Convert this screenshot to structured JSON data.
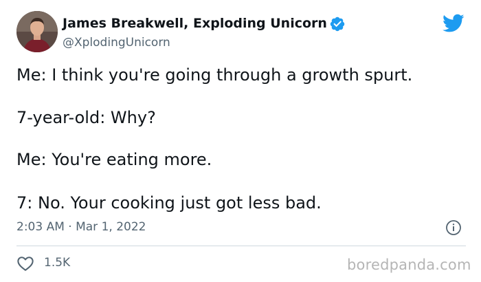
{
  "tweet": {
    "author": {
      "display_name": "James Breakwell, Exploding Unicorn",
      "handle": "@XplodingUnicorn",
      "verified": true
    },
    "lines": [
      "Me: I think you're going through a growth spurt.",
      "7-year-old: Why?",
      "Me: You're eating more.",
      "7: No. Your cooking just got less bad."
    ],
    "timestamp": "2:03 AM · Mar 1, 2022",
    "likes": "1.5K"
  },
  "icons": {
    "platform": "twitter-bird-icon",
    "verified": "verified-badge-icon",
    "info": "info-icon",
    "like": "heart-icon"
  },
  "colors": {
    "accent": "#1d9bf0",
    "text": "#0f1419",
    "secondary": "#536471",
    "divider": "#cfd9de",
    "watermark": "#b5b5b5"
  },
  "watermark": "boredpanda.com"
}
